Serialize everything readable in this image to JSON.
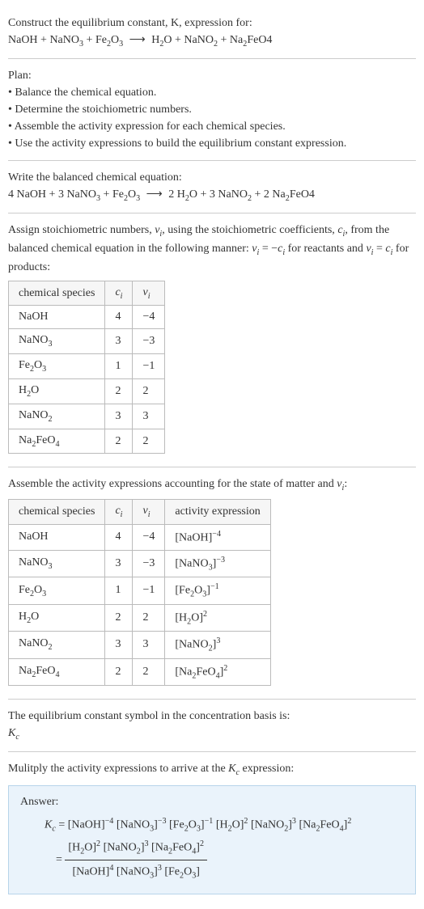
{
  "s1": {
    "l1": "Construct the equilibrium constant, K, expression for:",
    "l2a": "NaOH + NaNO",
    "l2b": "3",
    "l2c": " + Fe",
    "l2d": "2",
    "l2e": "O",
    "l2f": "3",
    "arrow": "⟶",
    "l2g": "H",
    "l2h": "2",
    "l2i": "O + NaNO",
    "l2j": "2",
    "l2k": " + Na",
    "l2l": "2",
    "l2m": "FeO4"
  },
  "s2": {
    "title": "Plan:",
    "b1": "• Balance the chemical equation.",
    "b2": "• Determine the stoichiometric numbers.",
    "b3": "• Assemble the activity expression for each chemical species.",
    "b4": "• Use the activity expressions to build the equilibrium constant expression."
  },
  "s3": {
    "l1": "Write the balanced chemical equation:",
    "l2a": "4 NaOH + 3 NaNO",
    "l2b": "3",
    "l2c": " + Fe",
    "l2d": "2",
    "l2e": "O",
    "l2f": "3",
    "arrow": "⟶",
    "l2g": "2 H",
    "l2h": "2",
    "l2i": "O + 3 NaNO",
    "l2j": "2",
    "l2k": " + 2 Na",
    "l2l": "2",
    "l2m": "FeO4"
  },
  "s4": {
    "p1a": "Assign stoichiometric numbers, ",
    "p1b": "ν",
    "p1c": "i",
    "p1d": ", using the stoichiometric coefficients, ",
    "p1e": "c",
    "p1f": "i",
    "p1g": ", from the balanced chemical equation in the following manner: ",
    "p1h": "ν",
    "p1i": "i",
    "p1j": " = −",
    "p1k": "c",
    "p1l": "i",
    "p1m": " for reactants and ",
    "p1n": "ν",
    "p1o": "i",
    "p1p": " = ",
    "p1q": "c",
    "p1r": "i",
    "p1s": " for products:",
    "h1": "chemical species",
    "h2a": "c",
    "h2b": "i",
    "h3a": "ν",
    "h3b": "i",
    "r1a": "NaOH",
    "r1c": "4",
    "r1v": "−4",
    "r2a": "NaNO",
    "r2s": "3",
    "r2c": "3",
    "r2v": "−3",
    "r3a": "Fe",
    "r3s1": "2",
    "r3b": "O",
    "r3s2": "3",
    "r3c": "1",
    "r3v": "−1",
    "r4a": "H",
    "r4s": "2",
    "r4b": "O",
    "r4c": "2",
    "r4v": "2",
    "r5a": "NaNO",
    "r5s": "2",
    "r5c": "3",
    "r5v": "3",
    "r6a": "Na",
    "r6s": "2",
    "r6b": "FeO",
    "r6s2": "4",
    "r6c": "2",
    "r6v": "2"
  },
  "s5": {
    "p1a": "Assemble the activity expressions accounting for the state of matter and ",
    "p1b": "ν",
    "p1c": "i",
    "p1d": ":",
    "h1": "chemical species",
    "h2a": "c",
    "h2b": "i",
    "h3a": "ν",
    "h3b": "i",
    "h4": "activity expression",
    "r1a": "NaOH",
    "r1c": "4",
    "r1v": "−4",
    "r1e1": "[NaOH]",
    "r1e2": "−4",
    "r2a": "NaNO",
    "r2s": "3",
    "r2c": "3",
    "r2v": "−3",
    "r2e1": "[NaNO",
    "r2e2": "3",
    "r2e3": "]",
    "r2e4": "−3",
    "r3a": "Fe",
    "r3s1": "2",
    "r3b": "O",
    "r3s2": "3",
    "r3c": "1",
    "r3v": "−1",
    "r3e1": "[Fe",
    "r3e2": "2",
    "r3e3": "O",
    "r3e4": "3",
    "r3e5": "]",
    "r3e6": "−1",
    "r4a": "H",
    "r4s": "2",
    "r4b": "O",
    "r4c": "2",
    "r4v": "2",
    "r4e1": "[H",
    "r4e2": "2",
    "r4e3": "O]",
    "r4e4": "2",
    "r5a": "NaNO",
    "r5s": "2",
    "r5c": "3",
    "r5v": "3",
    "r5e1": "[NaNO",
    "r5e2": "2",
    "r5e3": "]",
    "r5e4": "3",
    "r6a": "Na",
    "r6s": "2",
    "r6b": "FeO",
    "r6s2": "4",
    "r6c": "2",
    "r6v": "2",
    "r6e1": "[Na",
    "r6e2": "2",
    "r6e3": "FeO",
    "r6e4": "4",
    "r6e5": "]",
    "r6e6": "2"
  },
  "s6": {
    "l1": "The equilibrium constant symbol in the concentration basis is:",
    "sym1": "K",
    "sym2": "c"
  },
  "s7": {
    "l1a": "Mulitply the activity expressions to arrive at the ",
    "l1b": "K",
    "l1c": "c",
    "l1d": " expression:",
    "ans_title": "Answer:",
    "kc1": "K",
    "kc2": "c",
    "eq": " = ",
    "t1": "[NaOH]",
    "t1p": "−4",
    "sp": " ",
    "t2a": "[NaNO",
    "t2b": "3",
    "t2c": "]",
    "t2p": "−3",
    "t3a": "[Fe",
    "t3b": "2",
    "t3c": "O",
    "t3d": "3",
    "t3e": "]",
    "t3p": "−1",
    "t4a": "[H",
    "t4b": "2",
    "t4c": "O]",
    "t4p": "2",
    "t5a": "[NaNO",
    "t5b": "2",
    "t5c": "]",
    "t5p": "3",
    "t6a": "[Na",
    "t6b": "2",
    "t6c": "FeO",
    "t6d": "4",
    "t6e": "]",
    "t6p": "2",
    "eq2": " = ",
    "n1a": "[H",
    "n1b": "2",
    "n1c": "O]",
    "n1p": "2",
    "n2a": "[NaNO",
    "n2b": "2",
    "n2c": "]",
    "n2p": "3",
    "n3a": "[Na",
    "n3b": "2",
    "n3c": "FeO",
    "n3d": "4",
    "n3e": "]",
    "n3p": "2",
    "d1": "[NaOH]",
    "d1p": "4",
    "d2a": "[NaNO",
    "d2b": "3",
    "d2c": "]",
    "d2p": "3",
    "d3a": "[Fe",
    "d3b": "2",
    "d3c": "O",
    "d3d": "3",
    "d3e": "]"
  }
}
